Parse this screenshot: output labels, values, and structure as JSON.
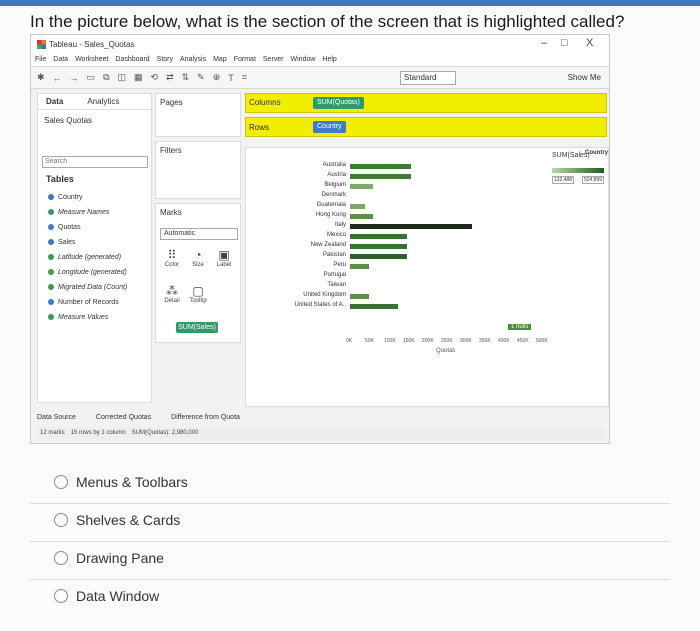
{
  "question": "In the picture below, what is the section of the screen that is highlighted called?",
  "screenshot": {
    "window_title": "Tableau - Sales_Quotas",
    "window_controls": [
      "–",
      "□",
      "X"
    ],
    "menu": [
      "File",
      "Data",
      "Worksheet",
      "Dashboard",
      "Story",
      "Analysis",
      "Map",
      "Format",
      "Server",
      "Window",
      "Help"
    ],
    "toolbar_select": "Standard",
    "show_me": "Show Me",
    "data_pane": {
      "tabs": [
        "Data",
        "Analytics"
      ],
      "datasource": "Sales Quotas",
      "search_placeholder": "Search",
      "tables_heading": "Tables",
      "fields": [
        {
          "label": "Country",
          "kind": "dim"
        },
        {
          "label": "Measure Names",
          "kind": "meas"
        },
        {
          "label": "Quotas",
          "kind": "dim"
        },
        {
          "label": "Sales",
          "kind": "dim"
        },
        {
          "label": "Latitude (generated)",
          "kind": "meas"
        },
        {
          "label": "Longitude (generated)",
          "kind": "meas"
        },
        {
          "label": "Migrated Data (Count)",
          "kind": "meas"
        },
        {
          "label": "Number of Records",
          "kind": "dim"
        },
        {
          "label": "Measure Values",
          "kind": "meas"
        }
      ]
    },
    "pages_label": "Pages",
    "filters_label": "Filters",
    "marks": {
      "label": "Marks",
      "type": "Automatic",
      "buttons": [
        "Color",
        "Size",
        "Label",
        "Detail",
        "Tooltip"
      ],
      "pill": "SUM(Sales)"
    },
    "shelves": {
      "columns_label": "Columns",
      "columns_pill": "SUM(Quotas)",
      "rows_label": "Rows",
      "rows_pill": "Country"
    },
    "viz": {
      "row_header": "Country",
      "countries": [
        "Australia",
        "Austria",
        "Belgium",
        "Denmark",
        "Guatemala",
        "Hong Kong",
        "Italy",
        "Mexico",
        "New Zealand",
        "Pakistan",
        "Peru",
        "Portugal",
        "Taiwan",
        "United Kingdom",
        "United States of A.."
      ],
      "axis_ticks": [
        "0K",
        "50K",
        "100K",
        "150K",
        "200K",
        "250K",
        "300K",
        "350K",
        "400K",
        "450K",
        "500K"
      ],
      "axis_title": "Quotas",
      "nulls_badge": "1 nulls",
      "legend_title": "SUM(Sales)",
      "legend_min": "132,488",
      "legend_max": "524,899"
    },
    "bottom_tabs": [
      "Data Source",
      "Corrected Quotas",
      "Difference from Quota"
    ],
    "status_bar": [
      "12 marks",
      "15 rows by 1 column",
      "SUM(Quotas): 2,980,000"
    ]
  },
  "chart_data": {
    "type": "bar",
    "categories": [
      "Australia",
      "Austria",
      "Belgium",
      "Denmark",
      "Guatemala",
      "Hong Kong",
      "Italy",
      "Mexico",
      "New Zealand",
      "Pakistan",
      "Peru",
      "Portugal",
      "Taiwan",
      "United Kingdom",
      "United States of A.."
    ],
    "values": [
      160000,
      160000,
      60000,
      0,
      40000,
      60000,
      320000,
      150000,
      150000,
      150000,
      50000,
      0,
      0,
      50000,
      125000
    ],
    "xlabel": "Quotas",
    "ylabel": "Country",
    "xlim": [
      0,
      500000
    ],
    "color_legend": {
      "title": "SUM(Sales)",
      "min": 132488,
      "max": 524899,
      "low_color": "#b9d9a7",
      "high_color": "#1f5a1f"
    },
    "bar_colors": [
      "#3f7a38",
      "#3f7a38",
      "#7fa86e",
      "#7fa86e",
      "#7fa86e",
      "#5b8f4e",
      "#1c2b1c",
      "#3a7034",
      "#3a7034",
      "#2f5f2a",
      "#5b8f4e",
      "#7fa86e",
      "#7fa86e",
      "#5b8f4e",
      "#3a7034"
    ]
  },
  "options": [
    "Menus & Toolbars",
    "Shelves & Cards",
    "Drawing Pane",
    "Data Window"
  ]
}
